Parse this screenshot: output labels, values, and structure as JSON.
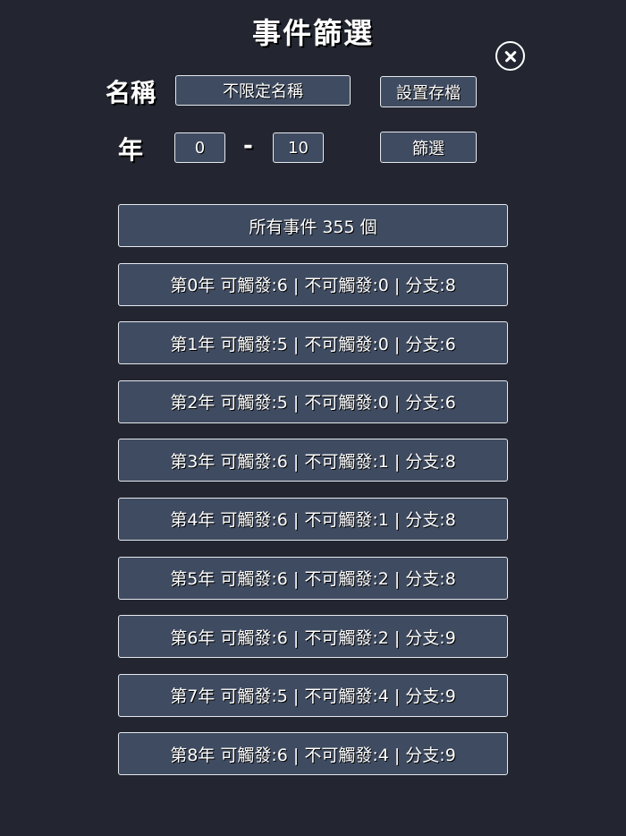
{
  "title": "事件篩選",
  "name_label": "名稱",
  "name_value": "不限定名稱",
  "save_button": "設置存檔",
  "year_label": "年",
  "year_from": "0",
  "year_separator": "-",
  "year_to": "10",
  "filter_button": "篩選",
  "summary": "所有事件 355 個",
  "years": [
    "第0年 可觸發:6 | 不可觸發:0 | 分支:8",
    "第1年 可觸發:5 | 不可觸發:0 | 分支:6",
    "第2年 可觸發:5 | 不可觸發:0 | 分支:6",
    "第3年 可觸發:6 | 不可觸發:1 | 分支:8",
    "第4年 可觸發:6 | 不可觸發:1 | 分支:8",
    "第5年 可觸發:6 | 不可觸發:2 | 分支:8",
    "第6年 可觸發:6 | 不可觸發:2 | 分支:9",
    "第7年 可觸發:5 | 不可觸發:4 | 分支:9",
    "第8年 可觸發:6 | 不可觸發:4 | 分支:9"
  ],
  "icons": {
    "close": "close-icon"
  }
}
